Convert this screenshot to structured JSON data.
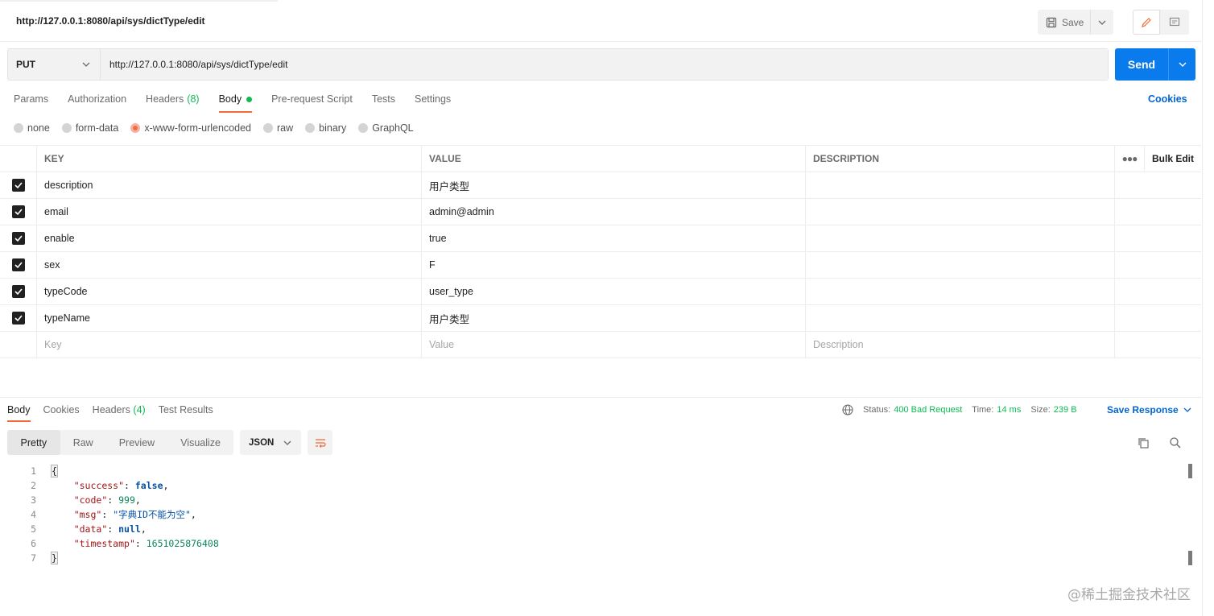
{
  "request": {
    "title": "http://127.0.0.1:8080/api/sys/dictType/edit",
    "method": "PUT",
    "url": "http://127.0.0.1:8080/api/sys/dictType/edit",
    "save_label": "Save",
    "send_label": "Send"
  },
  "request_tabs": {
    "params": "Params",
    "authorization": "Authorization",
    "headers": "Headers",
    "headers_count": "(8)",
    "body": "Body",
    "prerequest": "Pre-request Script",
    "tests": "Tests",
    "settings": "Settings",
    "cookies": "Cookies"
  },
  "body_types": {
    "none": "none",
    "form_data": "form-data",
    "urlencoded": "x-www-form-urlencoded",
    "raw": "raw",
    "binary": "binary",
    "graphql": "GraphQL",
    "selected": "x-www-form-urlencoded"
  },
  "params_table": {
    "headers": {
      "key": "KEY",
      "value": "VALUE",
      "description": "DESCRIPTION",
      "bulk_edit": "Bulk Edit"
    },
    "rows": [
      {
        "key": "description",
        "value": "用户类型",
        "checked": true
      },
      {
        "key": "email",
        "value": "admin@admin",
        "checked": true
      },
      {
        "key": "enable",
        "value": "true",
        "checked": true
      },
      {
        "key": "sex",
        "value": "F",
        "checked": true
      },
      {
        "key": "typeCode",
        "value": "user_type",
        "checked": true
      },
      {
        "key": "typeName",
        "value": "用户类型",
        "checked": true
      }
    ],
    "placeholders": {
      "key": "Key",
      "value": "Value",
      "description": "Description"
    }
  },
  "response": {
    "tabs": {
      "body": "Body",
      "cookies": "Cookies",
      "headers": "Headers",
      "headers_count": "(4)",
      "test_results": "Test Results"
    },
    "status_label": "Status:",
    "status_value": "400 Bad Request",
    "time_label": "Time:",
    "time_value": "14 ms",
    "size_label": "Size:",
    "size_value": "239 B",
    "save_response": "Save Response",
    "views": {
      "pretty": "Pretty",
      "raw": "Raw",
      "preview": "Preview",
      "visualize": "Visualize"
    },
    "format": "JSON",
    "code_lines": [
      {
        "n": "1",
        "text": "{"
      },
      {
        "n": "2",
        "key": "\"success\"",
        "val": "false",
        "valtype": "kw"
      },
      {
        "n": "3",
        "key": "\"code\"",
        "val": "999",
        "valtype": "num"
      },
      {
        "n": "4",
        "key": "\"msg\"",
        "val": "\"字典ID不能为空\"",
        "valtype": "str"
      },
      {
        "n": "5",
        "key": "\"data\"",
        "val": "null",
        "valtype": "kw"
      },
      {
        "n": "6",
        "key": "\"timestamp\"",
        "val": "1651025876408",
        "valtype": "num"
      },
      {
        "n": "7",
        "text": "}"
      }
    ]
  },
  "watermark": "@稀土掘金技术社区",
  "colors": {
    "accent": "#f26b3a",
    "send": "#097bed",
    "success": "#0cbb52",
    "link": "#0265d2"
  }
}
